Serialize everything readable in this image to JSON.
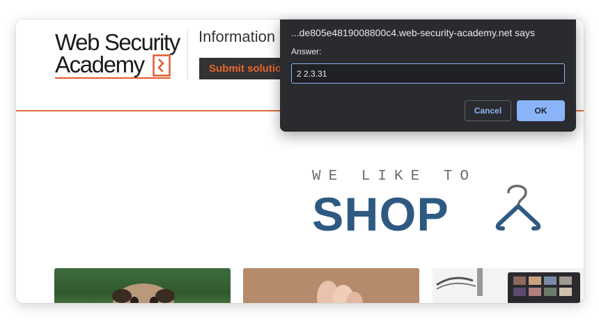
{
  "header": {
    "logo_line1": "Web Security",
    "logo_line2": "Academy",
    "lab_title": "Information",
    "submit_label": "Submit solutio"
  },
  "banner": {
    "small_text": "WE LIKE TO",
    "big_text": "SHOP"
  },
  "dialog": {
    "title": "...de805e4819008800c4.web-security-academy.net says",
    "label": "Answer:",
    "input_value": "2 2.3.31",
    "cancel_label": "Cancel",
    "ok_label": "OK"
  },
  "colors": {
    "brand_orange": "#e05a2b",
    "shop_blue": "#2e5a82",
    "dialog_bg": "#2a2b2e",
    "dialog_accent": "#8ab4f8"
  },
  "icons": [
    "logo-mark-icon",
    "hanger-icon"
  ]
}
